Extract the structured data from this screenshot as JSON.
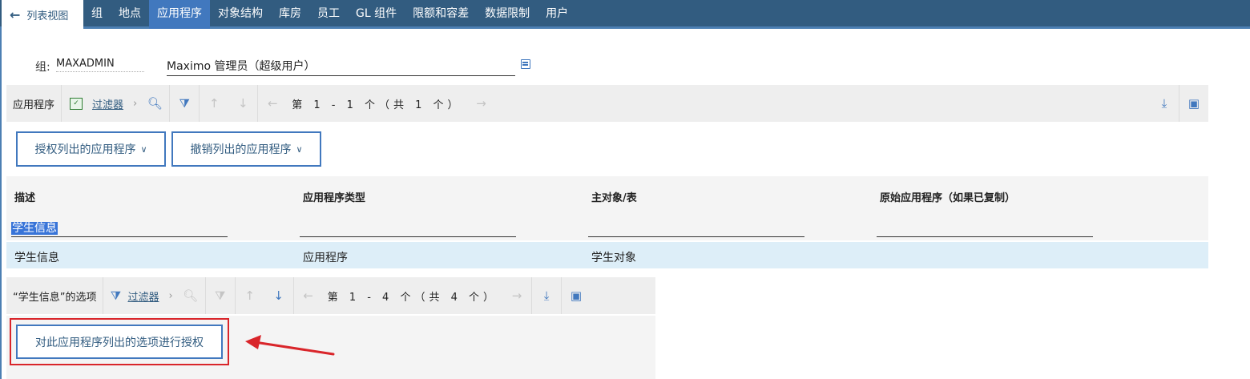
{
  "nav": {
    "back_label": "列表视图",
    "tabs": [
      {
        "label": "组"
      },
      {
        "label": "地点"
      },
      {
        "label": "应用程序"
      },
      {
        "label": "对象结构"
      },
      {
        "label": "库房"
      },
      {
        "label": "员工"
      },
      {
        "label": "GL 组件"
      },
      {
        "label": "限额和容差"
      },
      {
        "label": "数据限制"
      },
      {
        "label": "用户"
      }
    ],
    "active_tab": "应用程序"
  },
  "group": {
    "label": "组:",
    "id": "MAXADMIN",
    "description": "Maximo 管理员（超级用户）"
  },
  "apps_toolbar": {
    "title": "应用程序",
    "filter_label": "过滤器",
    "paging": "第 1 - 1 个（共 1 个）"
  },
  "actions": {
    "grant_label": "授权列出的应用程序",
    "revoke_label": "撤销列出的应用程序"
  },
  "table": {
    "columns": [
      "描述",
      "应用程序类型",
      "主对象/表",
      "原始应用程序（如果已复制）"
    ],
    "filter_values": [
      "学生信息",
      "",
      "",
      ""
    ],
    "rows": [
      {
        "cells": [
          "学生信息",
          "应用程序",
          "学生对象",
          ""
        ]
      }
    ]
  },
  "options_toolbar": {
    "title": "“学生信息”的选项",
    "filter_label": "过滤器",
    "paging": "第 1 - 4 个（共 4 个）"
  },
  "options_action": {
    "label": "对此应用程序列出的选项进行授权"
  },
  "colors": {
    "nav_bg": "#325c80",
    "active_tab": "#4178be",
    "accent": "#4178be",
    "highlight_red": "#d9252a",
    "selected_row": "#ddeef8"
  }
}
